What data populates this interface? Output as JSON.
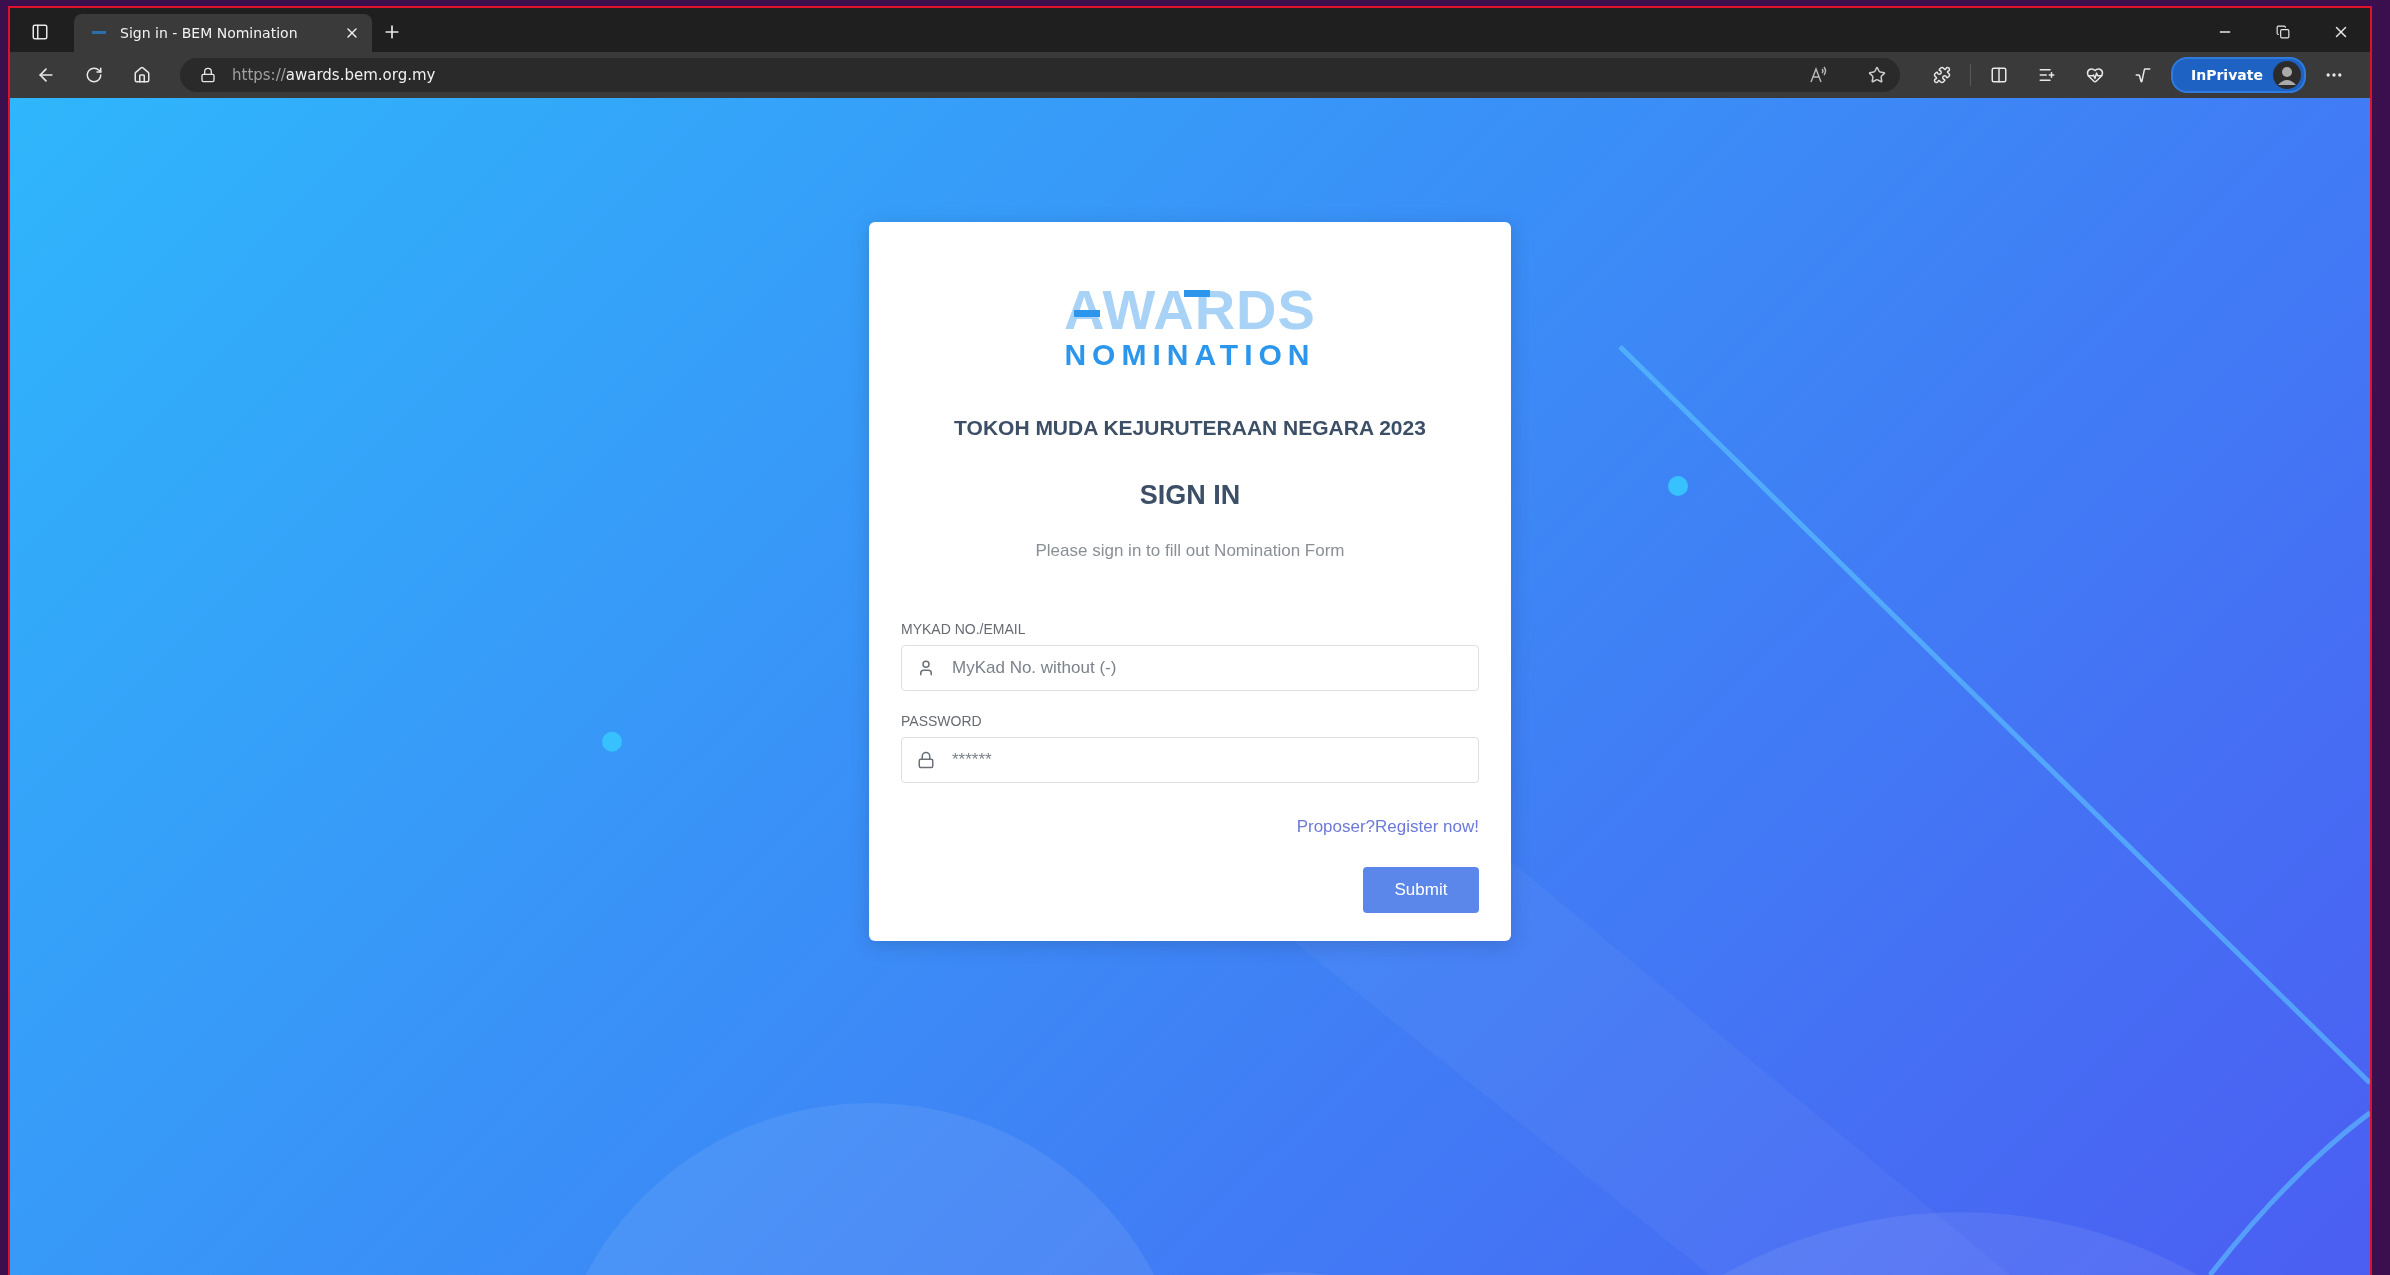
{
  "browser": {
    "tab_title": "Sign in - BEM Nomination",
    "address": {
      "scheme": "https://",
      "host": "awards.bem.org.my"
    },
    "inprivate_label": "InPrivate"
  },
  "logo": {
    "top": "AWARDS",
    "bottom": "NOMINATION"
  },
  "event_title": "TOKOH MUDA KEJURUTERAAN NEGARA 2023",
  "heading": "SIGN IN",
  "subtitle": "Please sign in to fill out Nomination Form",
  "fields": [
    {
      "label": "MYKAD NO./EMAIL",
      "placeholder": "MyKad No. without (-)",
      "kind": "user"
    },
    {
      "label": "PASSWORD",
      "placeholder": "******",
      "kind": "password"
    }
  ],
  "register_link": "Proposer?Register now!",
  "submit": "Submit"
}
